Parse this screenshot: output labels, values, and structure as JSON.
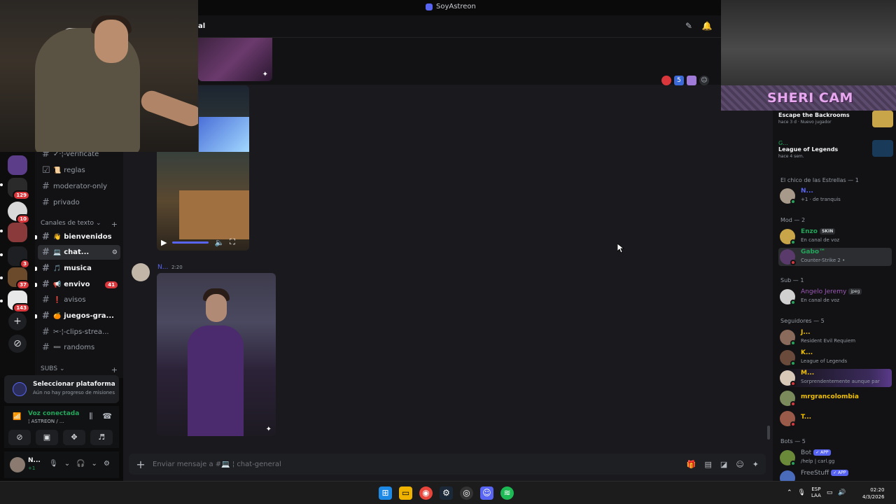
{
  "window": {
    "title": "SoyAstreon"
  },
  "header": {
    "channel_fragment": "al"
  },
  "servers": [
    {
      "badge": ""
    },
    {
      "badge": "129"
    },
    {
      "badge": "10"
    },
    {
      "badge": ""
    },
    {
      "badge": "3"
    },
    {
      "badge": "37"
    },
    {
      "badge": "143"
    }
  ],
  "channels": [
    {
      "label": "✓·¦-verificate",
      "emoji": "",
      "bold": false
    },
    {
      "label": "reglas",
      "emoji": "📜",
      "bold": false
    },
    {
      "label": "moderator-only",
      "emoji": "",
      "bold": false
    },
    {
      "label": "privado",
      "emoji": "",
      "bold": false
    },
    {
      "label": "bienvenidos",
      "emoji": "👋",
      "bold": true
    },
    {
      "label": "chat...",
      "emoji": "💻",
      "bold": true,
      "active": true
    },
    {
      "label": "musica",
      "emoji": "🎵",
      "bold": true
    },
    {
      "label": "envivo",
      "emoji": "📢",
      "bold": true,
      "badge": "41"
    },
    {
      "label": "avisos",
      "emoji": "❗",
      "bold": false
    },
    {
      "label": "juegos-gra...",
      "emoji": "🍊",
      "bold": true
    },
    {
      "label": "✂·¦-clips-strea...",
      "emoji": "",
      "bold": false
    },
    {
      "label": "randoms",
      "emoji": "➖",
      "bold": false
    }
  ],
  "categories": {
    "text": "Canales de texto",
    "subs": "SUBS"
  },
  "video_message": {
    "play": "▶",
    "vol": "🔈",
    "full": "⛶"
  },
  "message": {
    "author": "N...",
    "time": "2:20"
  },
  "reactions": [
    "5"
  ],
  "composer": {
    "placeholder": "Enviar mensaje a #💻 ¦ chat-general"
  },
  "quest": {
    "title": "Seleccionar plataforma",
    "subtitle": "Aún no hay progreso de misiones"
  },
  "voice": {
    "status": "Voz conectada",
    "channel": "¦ ASTREON / ..."
  },
  "user": {
    "name": "N...",
    "status": "+1"
  },
  "overlay": {
    "label": "SHERI CAM"
  },
  "members": {
    "games": [
      {
        "name": "Escape the Backrooms",
        "sub": "hace 3 d · Nuevo jugador"
      },
      {
        "user": "G...",
        "name": "League of Legends",
        "sub": "hace 4 sem."
      }
    ],
    "groups": [
      {
        "title": "El chico de las Estrellas — 1"
      },
      {
        "title": "Mod — 2"
      },
      {
        "title": "Sub — 1"
      },
      {
        "title": "Seguidores — 5"
      },
      {
        "title": "Bots — 5"
      }
    ],
    "list": [
      {
        "name": "N...",
        "activity": "+1 · de tranquis",
        "color": "#5865f2",
        "status": "#23a55a"
      },
      {
        "name": "Enzo",
        "tag": "SKIN",
        "activity": "En canal de voz",
        "color": "#23a55a",
        "status": "#23a55a"
      },
      {
        "name": "Gabo™",
        "activity": "Counter-Strike 2 •",
        "color": "#23a55a",
        "status": "#da373c"
      },
      {
        "name": "Angelo Jeremy",
        "tag": "jpeg",
        "activity": "En canal de voz",
        "color": "#9b59b6",
        "status": "#23a55a"
      },
      {
        "name": "J...",
        "activity": "Resident Evil Requiem",
        "color": "#f0c000",
        "status": "#23a55a"
      },
      {
        "name": "K...",
        "activity": "League of Legends",
        "color": "#f0c000",
        "status": "#23a55a"
      },
      {
        "name": "M...",
        "activity": "Sorprendentemente aunque par",
        "color": "#f0c000",
        "status": "#da373c"
      },
      {
        "name": "mrgrancolombia",
        "activity": "",
        "color": "#f0c000",
        "status": "#da373c"
      },
      {
        "name": "T...",
        "activity": "",
        "color": "#f0c000",
        "status": "#da373c"
      },
      {
        "name": "Bot",
        "tag": "✓ APP",
        "activity": "/help | carl.gg",
        "color": "#949ba4",
        "status": "#23a55a"
      },
      {
        "name": "FreeStuff",
        "tag": "✓ APP",
        "activity": "",
        "color": "#949ba4",
        "status": "#23a55a"
      }
    ]
  },
  "taskbar": {
    "lang": "ESP",
    "lang2": "LAA",
    "time": "02:20",
    "date": "4/3/2026"
  }
}
